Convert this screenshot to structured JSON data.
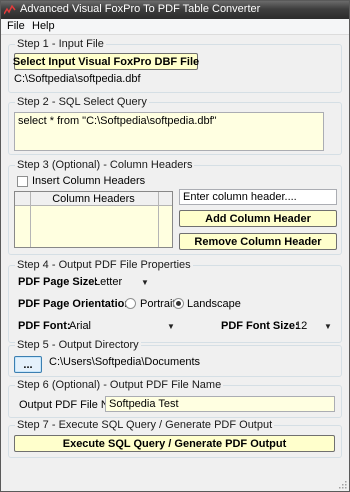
{
  "window": {
    "title": "Advanced Visual FoxPro To PDF Table Converter"
  },
  "menu": [
    {
      "label": "File"
    },
    {
      "label": "Help"
    }
  ],
  "step1": {
    "legend": "Step 1 - Input File",
    "button_label": "Select Input Visual FoxPro DBF File",
    "file_path": "C:\\Softpedia\\softpedia.dbf"
  },
  "step2": {
    "legend": "Step 2 - SQL Select Query",
    "query": "select * from \"C:\\Softpedia\\softpedia.dbf\""
  },
  "step3": {
    "legend": "Step 3 (Optional) - Column Headers",
    "checkbox_label": "Insert Column Headers",
    "grid_header": "Column Headers",
    "header_placeholder": "Enter column header....",
    "add_button": "Add Column Header",
    "remove_button": "Remove Column Header"
  },
  "step4": {
    "legend": "Step 4 - Output PDF File Properties",
    "page_size_label": "PDF Page Size:",
    "page_size_value": "Letter",
    "orientation_label": "PDF Page Orientation:",
    "orientation_options": [
      "Portrait",
      "Landscape"
    ],
    "orientation_selected": "Landscape",
    "font_label": "PDF Font:",
    "font_value": "Arial",
    "font_size_label": "PDF Font Size:",
    "font_size_value": "12"
  },
  "step5": {
    "legend": "Step 5 - Output Directory",
    "browse_label": "...",
    "directory": "C:\\Users\\Softpedia\\Documents"
  },
  "step6": {
    "legend": "Step 6 (Optional) - Output PDF File Name",
    "name_label": "Output PDF File Name:",
    "name_value": "Softpedia Test"
  },
  "step7": {
    "legend": "Step 7 - Execute SQL Query / Generate PDF Output",
    "execute_button": "Execute SQL Query / Generate PDF Output"
  },
  "colors": {
    "titlebar": "#3e3e3e",
    "button_yellow": "#ffffcc",
    "grid_bg": "#ffffe0",
    "textbox_yellow": "#ffffe1",
    "group_border": "#d5dfe5"
  }
}
